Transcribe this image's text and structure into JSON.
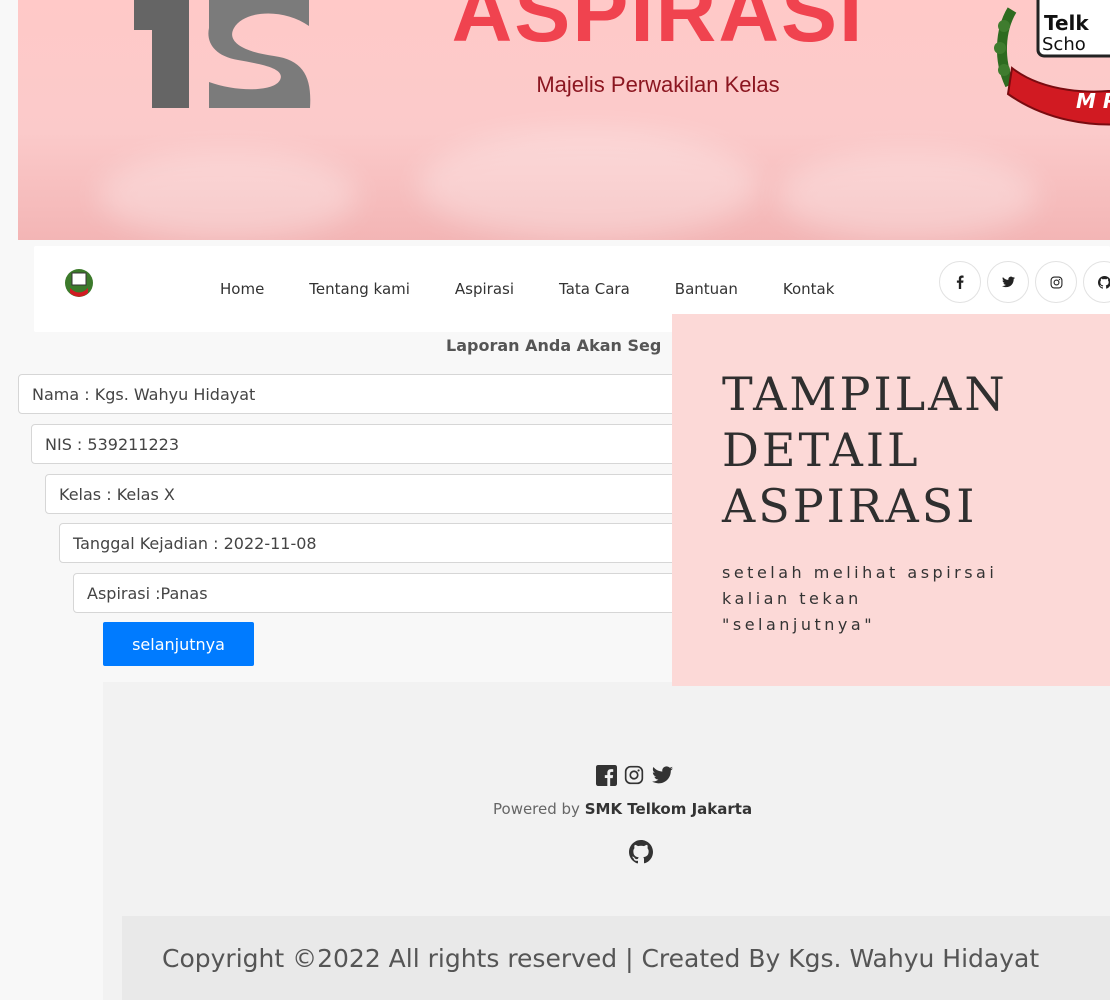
{
  "banner": {
    "title": "ASPIRASI",
    "subtitle": "Majelis Perwakilan Kelas",
    "emblem_text_1": "Telk",
    "emblem_text_2": "Scho",
    "emblem_ribbon": "M P"
  },
  "navbar": {
    "links": [
      "Home",
      "Tentang kami",
      "Aspirasi",
      "Tata Cara",
      "Bantuan",
      "Kontak"
    ],
    "social": [
      "facebook-icon",
      "twitter-icon",
      "instagram-icon",
      "github-icon"
    ]
  },
  "report": {
    "heading": "Laporan Anda Akan Seg"
  },
  "detail": {
    "nama": "Nama : Kgs. Wahyu Hidayat",
    "nis": "NIS : 539211223",
    "kelas": "Kelas : Kelas X",
    "tanggal": "Tanggal Kejadian : 2022-11-08",
    "aspirasi": "Aspirasi :Panas",
    "next_label": "selanjutnya"
  },
  "overlay": {
    "title_line1": "TAMPILAN",
    "title_line2": "DETAIL",
    "title_line3": "ASPIRASI",
    "desc_line1": "setelah melihat aspirsai",
    "desc_line2": "kalian tekan",
    "desc_line3": "\"selanjutnya\""
  },
  "footer": {
    "powered_prefix": "Powered by ",
    "powered_brand": "SMK Telkom Jakarta",
    "copyright": "Copyright ©2022 All rights reserved | Created By Kgs. Wahyu Hidayat"
  },
  "colors": {
    "accent": "#f0434f",
    "button": "#007bff",
    "overlay_bg": "#fcd9d7"
  }
}
